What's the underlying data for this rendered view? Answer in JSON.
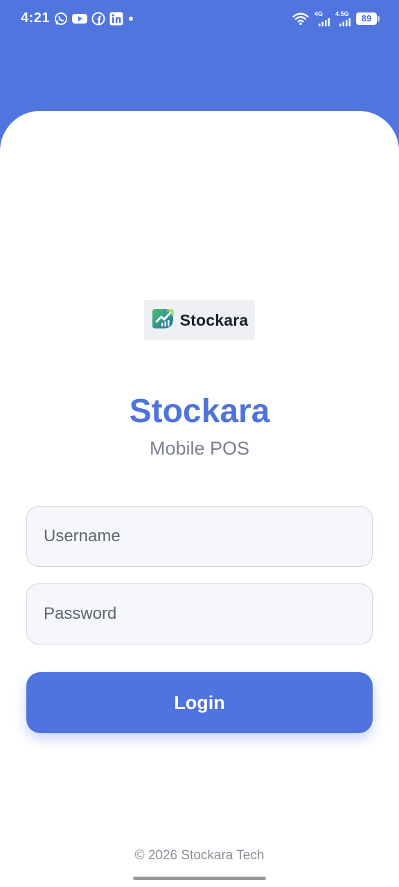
{
  "status_bar": {
    "time": "4:21",
    "notification_icons": [
      "whatsapp-icon",
      "youtube-icon",
      "facebook-icon",
      "linkedin-icon",
      "dot-icon"
    ],
    "network_1": "4G",
    "network_2": "4.5G",
    "battery": "89"
  },
  "logo": {
    "text": "Stockara"
  },
  "app": {
    "title": "Stockara",
    "subtitle": "Mobile POS"
  },
  "form": {
    "username_placeholder": "Username",
    "password_placeholder": "Password",
    "login_label": "Login"
  },
  "footer": {
    "text": "© 2026 Stockara Tech"
  },
  "colors": {
    "primary": "#5075df",
    "title": "#4e74dc",
    "field_bg": "#f6f7fb",
    "field_border": "#cdd3e0"
  }
}
